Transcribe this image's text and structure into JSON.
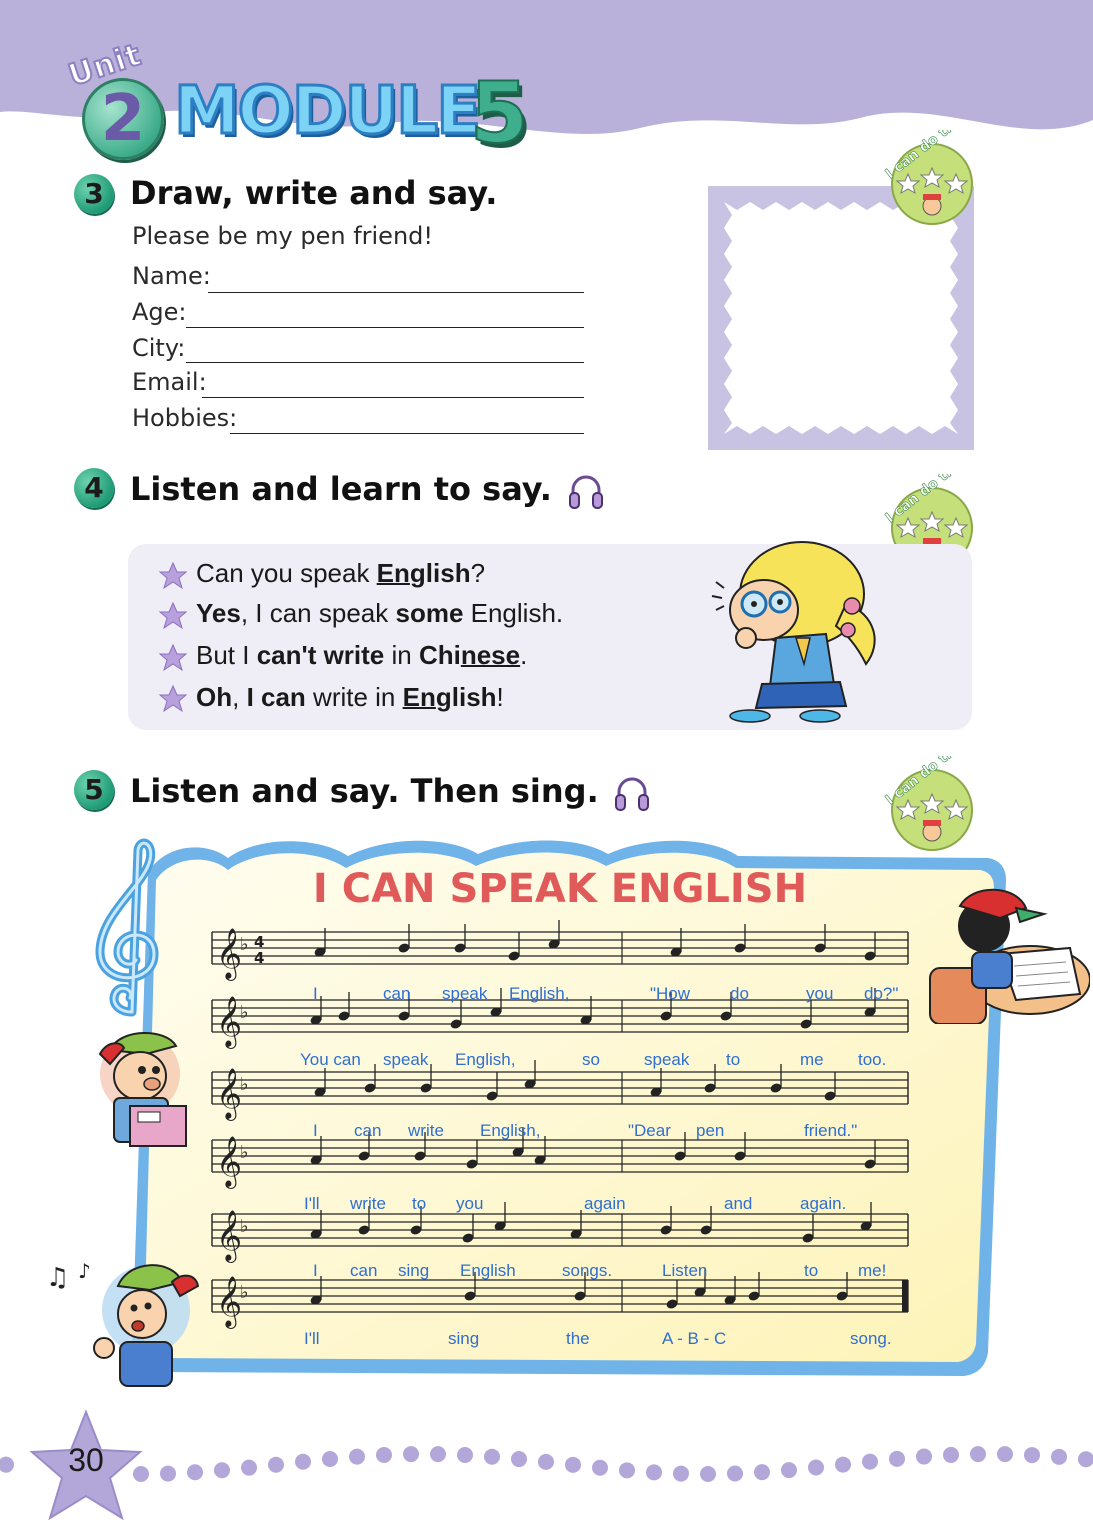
{
  "header": {
    "unit_word": "Unit",
    "unit_number": "2",
    "module_word": "MODULE",
    "module_number": "5"
  },
  "badge_text": "I can do this.",
  "sections": {
    "s3": {
      "number": "3",
      "title": "Draw, write and say.",
      "subtitle": "Please be my pen friend!",
      "fields": [
        "Name:",
        "Age:",
        "City:",
        "Email:",
        "Hobbies:"
      ]
    },
    "s4": {
      "number": "4",
      "title": "Listen and learn to say.",
      "icon": "headphones-icon",
      "lines": [
        "Can you speak English?",
        "Yes, I can speak some English.",
        "But I can't write in Chinese.",
        "Oh, I can write in English!"
      ]
    },
    "s5": {
      "number": "5",
      "title": "Listen and say. Then sing.",
      "icon": "headphones-icon",
      "song_title": "I CAN SPEAK ENGLISH",
      "time_signature": "4/4",
      "lyrics": [
        [
          "I",
          "can",
          "speak",
          "English,",
          "\"How",
          "do",
          "you",
          "do?\""
        ],
        [
          "You can",
          "speak",
          "English,",
          "so",
          "speak",
          "to",
          "me",
          "too."
        ],
        [
          "I",
          "can",
          "write",
          "English,",
          "\"Dear",
          "pen",
          "friend.\""
        ],
        [
          "I'll",
          "write",
          "to",
          "you",
          "again",
          "and",
          "again."
        ],
        [
          "I",
          "can",
          "sing",
          "English",
          "songs.",
          "Listen",
          "to",
          "me!"
        ],
        [
          "I'll",
          "sing",
          "the",
          "A - B - C",
          "song."
        ]
      ]
    }
  },
  "page_number": "30",
  "colors": {
    "header_band": "#b9b1da",
    "section_badge": "#1e9a74",
    "song_title": "#e05a5a",
    "lyrics": "#2f6fd0",
    "phrase_box": "#efedf5"
  }
}
